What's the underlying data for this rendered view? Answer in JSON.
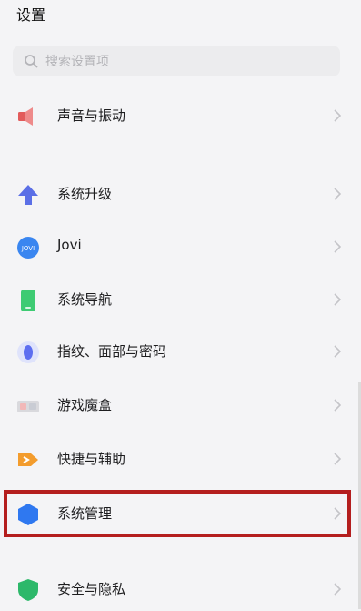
{
  "header": {
    "title": "设置"
  },
  "search": {
    "placeholder": "搜索设置项"
  },
  "items": [
    {
      "label": "声音与振动"
    },
    {
      "label": "系统升级"
    },
    {
      "label": "Jovi"
    },
    {
      "label": "系统导航"
    },
    {
      "label": "指纹、面部与密码"
    },
    {
      "label": "游戏魔盒"
    },
    {
      "label": "快捷与辅助"
    },
    {
      "label": "系统管理"
    },
    {
      "label": "安全与隐私"
    }
  ],
  "icons": {
    "sound": "speaker-icon",
    "upgrade": "arrow-up-icon",
    "jovi": "jovi-icon",
    "navigation": "phone-icon",
    "fingerprint": "fingerprint-icon",
    "game": "game-box-icon",
    "shortcut": "shortcut-icon",
    "system": "hexagon-icon",
    "security": "shield-icon",
    "jovi_badge_text": "JOVI"
  },
  "colors": {
    "highlight": "#b41e1e",
    "sound": "#e25b5b",
    "upgrade": "#5b6fe6",
    "jovi": "#3a86f0",
    "navigation": "#3ecb73",
    "fingerprint": "#5d6ef0",
    "shortcut": "#f39c2d",
    "system": "#2f78f0",
    "security": "#2db86a"
  }
}
